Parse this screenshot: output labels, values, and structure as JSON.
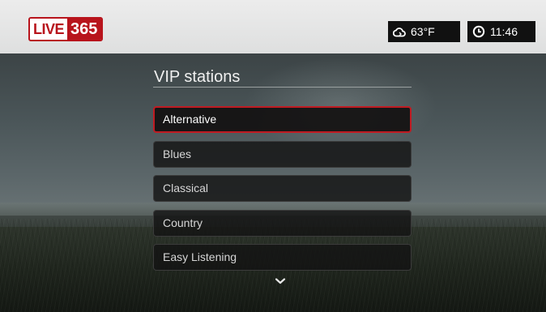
{
  "brand": {
    "logo_left": "LIVE",
    "logo_right": "365"
  },
  "status": {
    "weather_icon": "cloud-icon",
    "temperature": "63°F",
    "clock_icon": "clock-icon",
    "time": "11:46"
  },
  "menu": {
    "title": "VIP stations",
    "items": [
      {
        "label": "Alternative",
        "selected": true
      },
      {
        "label": "Blues"
      },
      {
        "label": "Classical"
      },
      {
        "label": "Country"
      },
      {
        "label": "Easy Listening"
      }
    ],
    "more_icon": "chevron-down-icon"
  },
  "colors": {
    "accent": "#c01b22",
    "brand_red": "#b8141c"
  }
}
